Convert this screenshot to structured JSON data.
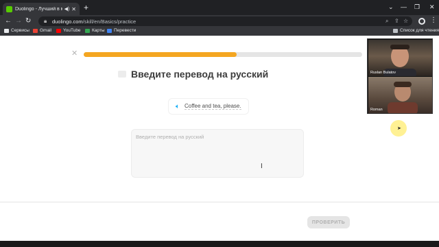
{
  "browser": {
    "tab_title": "Duolingo - Лучший в мире",
    "url_host": "duolingo.com",
    "url_path": "/skill/en/Basics/practice",
    "bookmarks": [
      "Сервисы",
      "Gmail",
      "YouTube",
      "Карты",
      "Перевести"
    ],
    "reading_list": "Список для чтения"
  },
  "lesson": {
    "progress_fraction": 0.55,
    "progress_color": "#f4a621",
    "heading": "Введите перевод на русский",
    "phrase": "Coffee and tea, please.",
    "answer_placeholder": "Введите перевод на русский",
    "check_button": "ПРОВЕРИТЬ"
  },
  "video_call": {
    "participants": [
      "Ruslan Bulatov",
      "Roman"
    ]
  },
  "icons": {
    "favicon": "duolingo-icon",
    "speaker": "speaker-icon",
    "close": "close-icon"
  }
}
